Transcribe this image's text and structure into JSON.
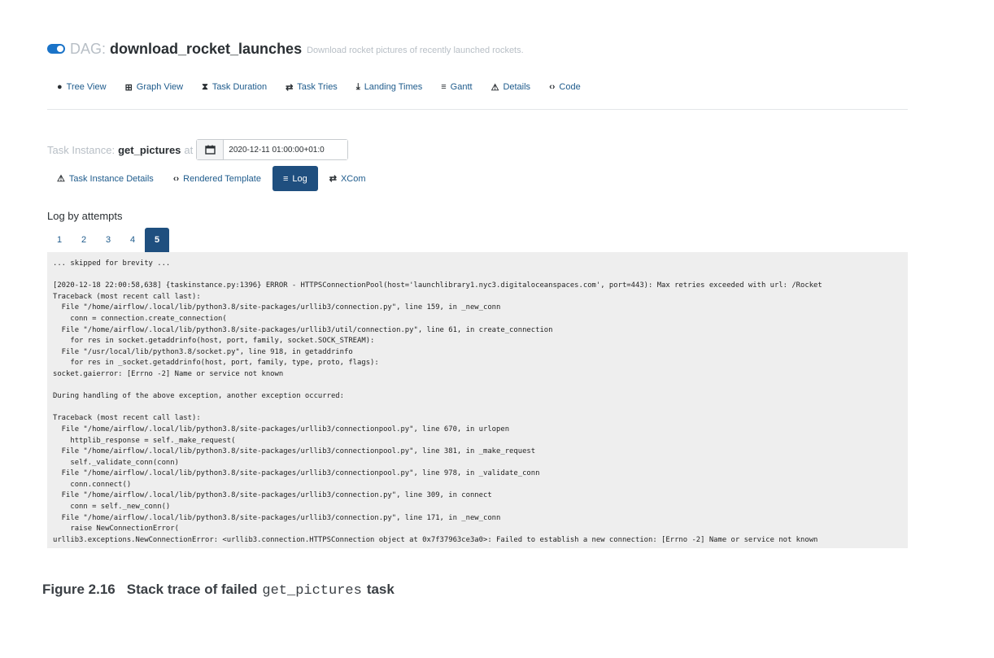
{
  "dag": {
    "prefix": "DAG:",
    "name": "download_rocket_launches",
    "description": "Download rocket pictures of recently launched rockets."
  },
  "nav": {
    "items": [
      {
        "icon": "tree-icon",
        "glyph": "●",
        "label": "Tree View"
      },
      {
        "icon": "graph-icon",
        "glyph": "⊞",
        "label": "Graph View"
      },
      {
        "icon": "hourglass-icon",
        "glyph": "⧗",
        "label": "Task Duration"
      },
      {
        "icon": "retry-icon",
        "glyph": "⇄",
        "label": "Task Tries"
      },
      {
        "icon": "landing-icon",
        "glyph": "⤓",
        "label": "Landing Times"
      },
      {
        "icon": "gantt-icon",
        "glyph": "≡",
        "label": "Gantt"
      },
      {
        "icon": "warning-icon",
        "glyph": "⚠",
        "label": "Details"
      },
      {
        "icon": "code-icon",
        "glyph": "‹›",
        "label": "Code"
      }
    ]
  },
  "task_instance": {
    "prefix": "Task Instance:",
    "name": "get_pictures",
    "at": "at",
    "date": "2020-12-11 01:00:00+01:0"
  },
  "ti_nav": {
    "items": [
      {
        "icon": "warning-icon",
        "glyph": "⚠",
        "label": "Task Instance Details",
        "active": false
      },
      {
        "icon": "code-icon",
        "glyph": "‹›",
        "label": "Rendered Template",
        "active": false
      },
      {
        "icon": "list-icon",
        "glyph": "≡",
        "label": "Log",
        "active": true
      },
      {
        "icon": "exchange-icon",
        "glyph": "⇄",
        "label": "XCom",
        "active": false
      }
    ]
  },
  "log": {
    "heading": "Log by attempts",
    "attempts": [
      "1",
      "2",
      "3",
      "4",
      "5"
    ],
    "active_attempt": "5",
    "text": "... skipped for brevity ...\n\n[2020-12-18 22:00:58,638] {taskinstance.py:1396} ERROR - HTTPSConnectionPool(host='launchlibrary1.nyc3.digitaloceanspaces.com', port=443): Max retries exceeded with url: /Rocket\nTraceback (most recent call last):\n  File \"/home/airflow/.local/lib/python3.8/site-packages/urllib3/connection.py\", line 159, in _new_conn\n    conn = connection.create_connection(\n  File \"/home/airflow/.local/lib/python3.8/site-packages/urllib3/util/connection.py\", line 61, in create_connection\n    for res in socket.getaddrinfo(host, port, family, socket.SOCK_STREAM):\n  File \"/usr/local/lib/python3.8/socket.py\", line 918, in getaddrinfo\n    for res in _socket.getaddrinfo(host, port, family, type, proto, flags):\nsocket.gaierror: [Errno -2] Name or service not known\n\nDuring handling of the above exception, another exception occurred:\n\nTraceback (most recent call last):\n  File \"/home/airflow/.local/lib/python3.8/site-packages/urllib3/connectionpool.py\", line 670, in urlopen\n    httplib_response = self._make_request(\n  File \"/home/airflow/.local/lib/python3.8/site-packages/urllib3/connectionpool.py\", line 381, in _make_request\n    self._validate_conn(conn)\n  File \"/home/airflow/.local/lib/python3.8/site-packages/urllib3/connectionpool.py\", line 978, in _validate_conn\n    conn.connect()\n  File \"/home/airflow/.local/lib/python3.8/site-packages/urllib3/connection.py\", line 309, in connect\n    conn = self._new_conn()\n  File \"/home/airflow/.local/lib/python3.8/site-packages/urllib3/connection.py\", line 171, in _new_conn\n    raise NewConnectionError(\nurllib3.exceptions.NewConnectionError: <urllib3.connection.HTTPSConnection object at 0x7f37963ce3a0>: Failed to establish a new connection: [Errno -2] Name or service not known"
  },
  "caption": {
    "label": "Figure 2.16",
    "text_before": "Stack trace of failed",
    "code": "get_pictures",
    "text_after": "task"
  },
  "colors": {
    "accent": "#1f4f7f",
    "link": "#1e5b8c",
    "toggle": "#1a73c8",
    "log_background": "#eeeeee"
  }
}
